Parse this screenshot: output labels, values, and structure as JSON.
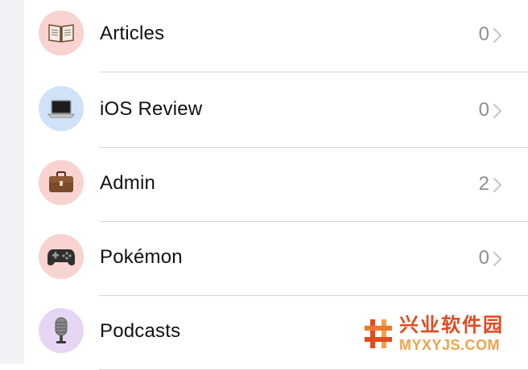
{
  "colors": {
    "separator": "#d7d7dc",
    "count_text": "#8e8e93",
    "chevron": "#c7c7cc",
    "gutter": "#f1f1f6"
  },
  "items": [
    {
      "label": "Articles",
      "count": "0",
      "icon": "open-book-icon",
      "icon_bg": "#f9d3d0"
    },
    {
      "label": "iOS Review",
      "count": "0",
      "icon": "laptop-icon",
      "icon_bg": "#cfe2f8"
    },
    {
      "label": "Admin",
      "count": "2",
      "icon": "briefcase-icon",
      "icon_bg": "#f9d3d0"
    },
    {
      "label": "Pokémon",
      "count": "0",
      "icon": "gamepad-icon",
      "icon_bg": "#f9d3d0"
    },
    {
      "label": "Podcasts",
      "count": "",
      "icon": "microphone-icon",
      "icon_bg": "#e7d6f3"
    }
  ],
  "watermark": {
    "title": "兴业软件园",
    "subtitle": "MYXYJS.COM"
  }
}
